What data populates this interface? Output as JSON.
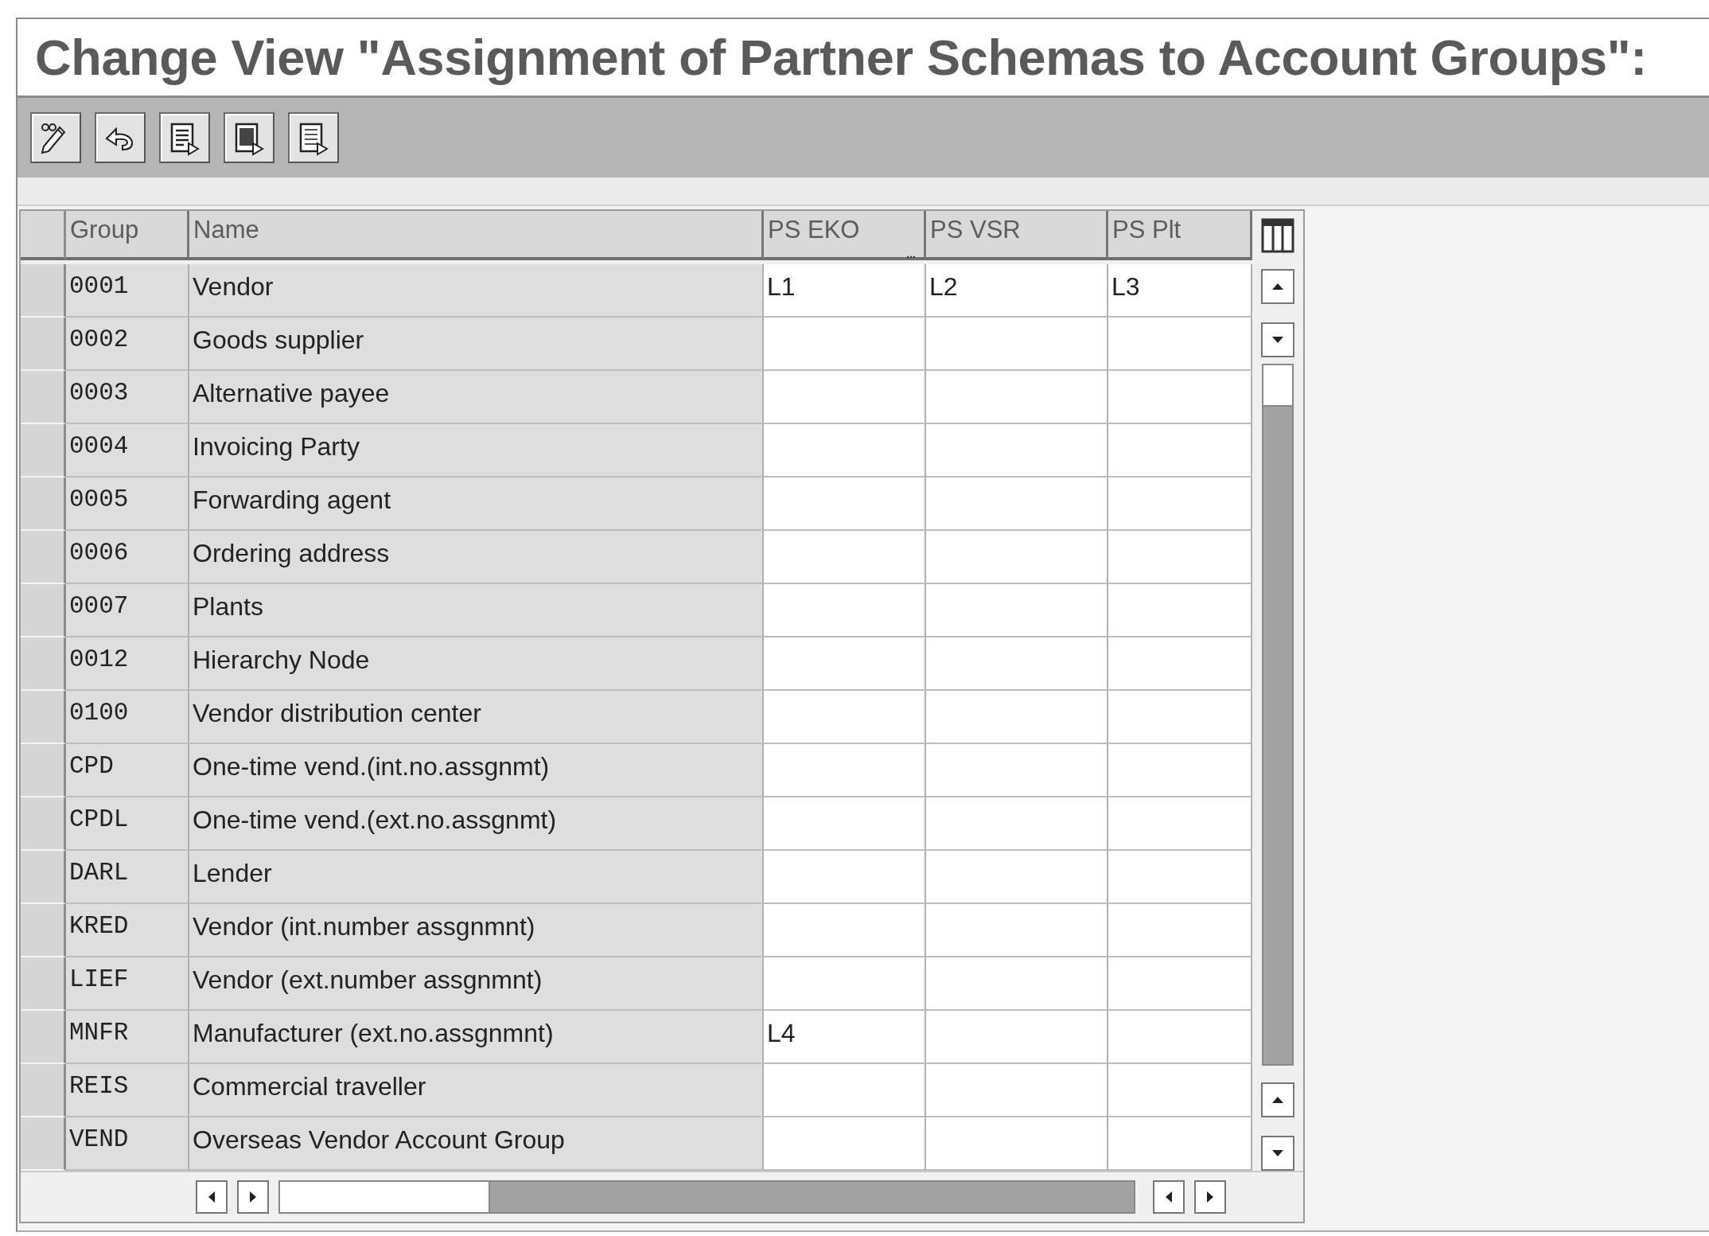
{
  "window": {
    "title": "Change View \"Assignment of Partner Schemas to Account Groups\":"
  },
  "toolbar": [
    {
      "kind": "edit"
    },
    {
      "kind": "undo"
    },
    {
      "kind": "select-all"
    },
    {
      "kind": "select-block"
    },
    {
      "kind": "deselect-all"
    }
  ],
  "table": {
    "columns": [
      {
        "label": "Group"
      },
      {
        "label": "Name"
      },
      {
        "label": "PS EKO",
        "overflow_mark": "..."
      },
      {
        "label": "PS VSR"
      },
      {
        "label": "PS Plt"
      }
    ],
    "rows": [
      {
        "group": "0001",
        "name": "Vendor",
        "ps_eko": "L1",
        "ps_vsr": "L2",
        "ps_plt": "L3"
      },
      {
        "group": "0002",
        "name": "Goods supplier"
      },
      {
        "group": "0003",
        "name": "Alternative payee"
      },
      {
        "group": "0004",
        "name": "Invoicing Party"
      },
      {
        "group": "0005",
        "name": "Forwarding agent"
      },
      {
        "group": "0006",
        "name": "Ordering address"
      },
      {
        "group": "0007",
        "name": "Plants"
      },
      {
        "group": "0012",
        "name": "Hierarchy Node"
      },
      {
        "group": "0100",
        "name": "Vendor distribution center"
      },
      {
        "group": "CPD",
        "name": "One-time vend.(int.no.assgnmt)"
      },
      {
        "group": "CPDL",
        "name": "One-time vend.(ext.no.assgnmt)"
      },
      {
        "group": "DARL",
        "name": "Lender"
      },
      {
        "group": "KRED",
        "name": "Vendor (int.number assgnmnt)"
      },
      {
        "group": "LIEF",
        "name": "Vendor (ext.number assgnmnt)"
      },
      {
        "group": "MNFR",
        "name": "Manufacturer (ext.no.assgnmnt)",
        "ps_eko": "L4"
      },
      {
        "group": "REIS",
        "name": "Commercial traveller"
      },
      {
        "group": "VEND",
        "name": "Overseas Vendor Account Group"
      }
    ]
  }
}
